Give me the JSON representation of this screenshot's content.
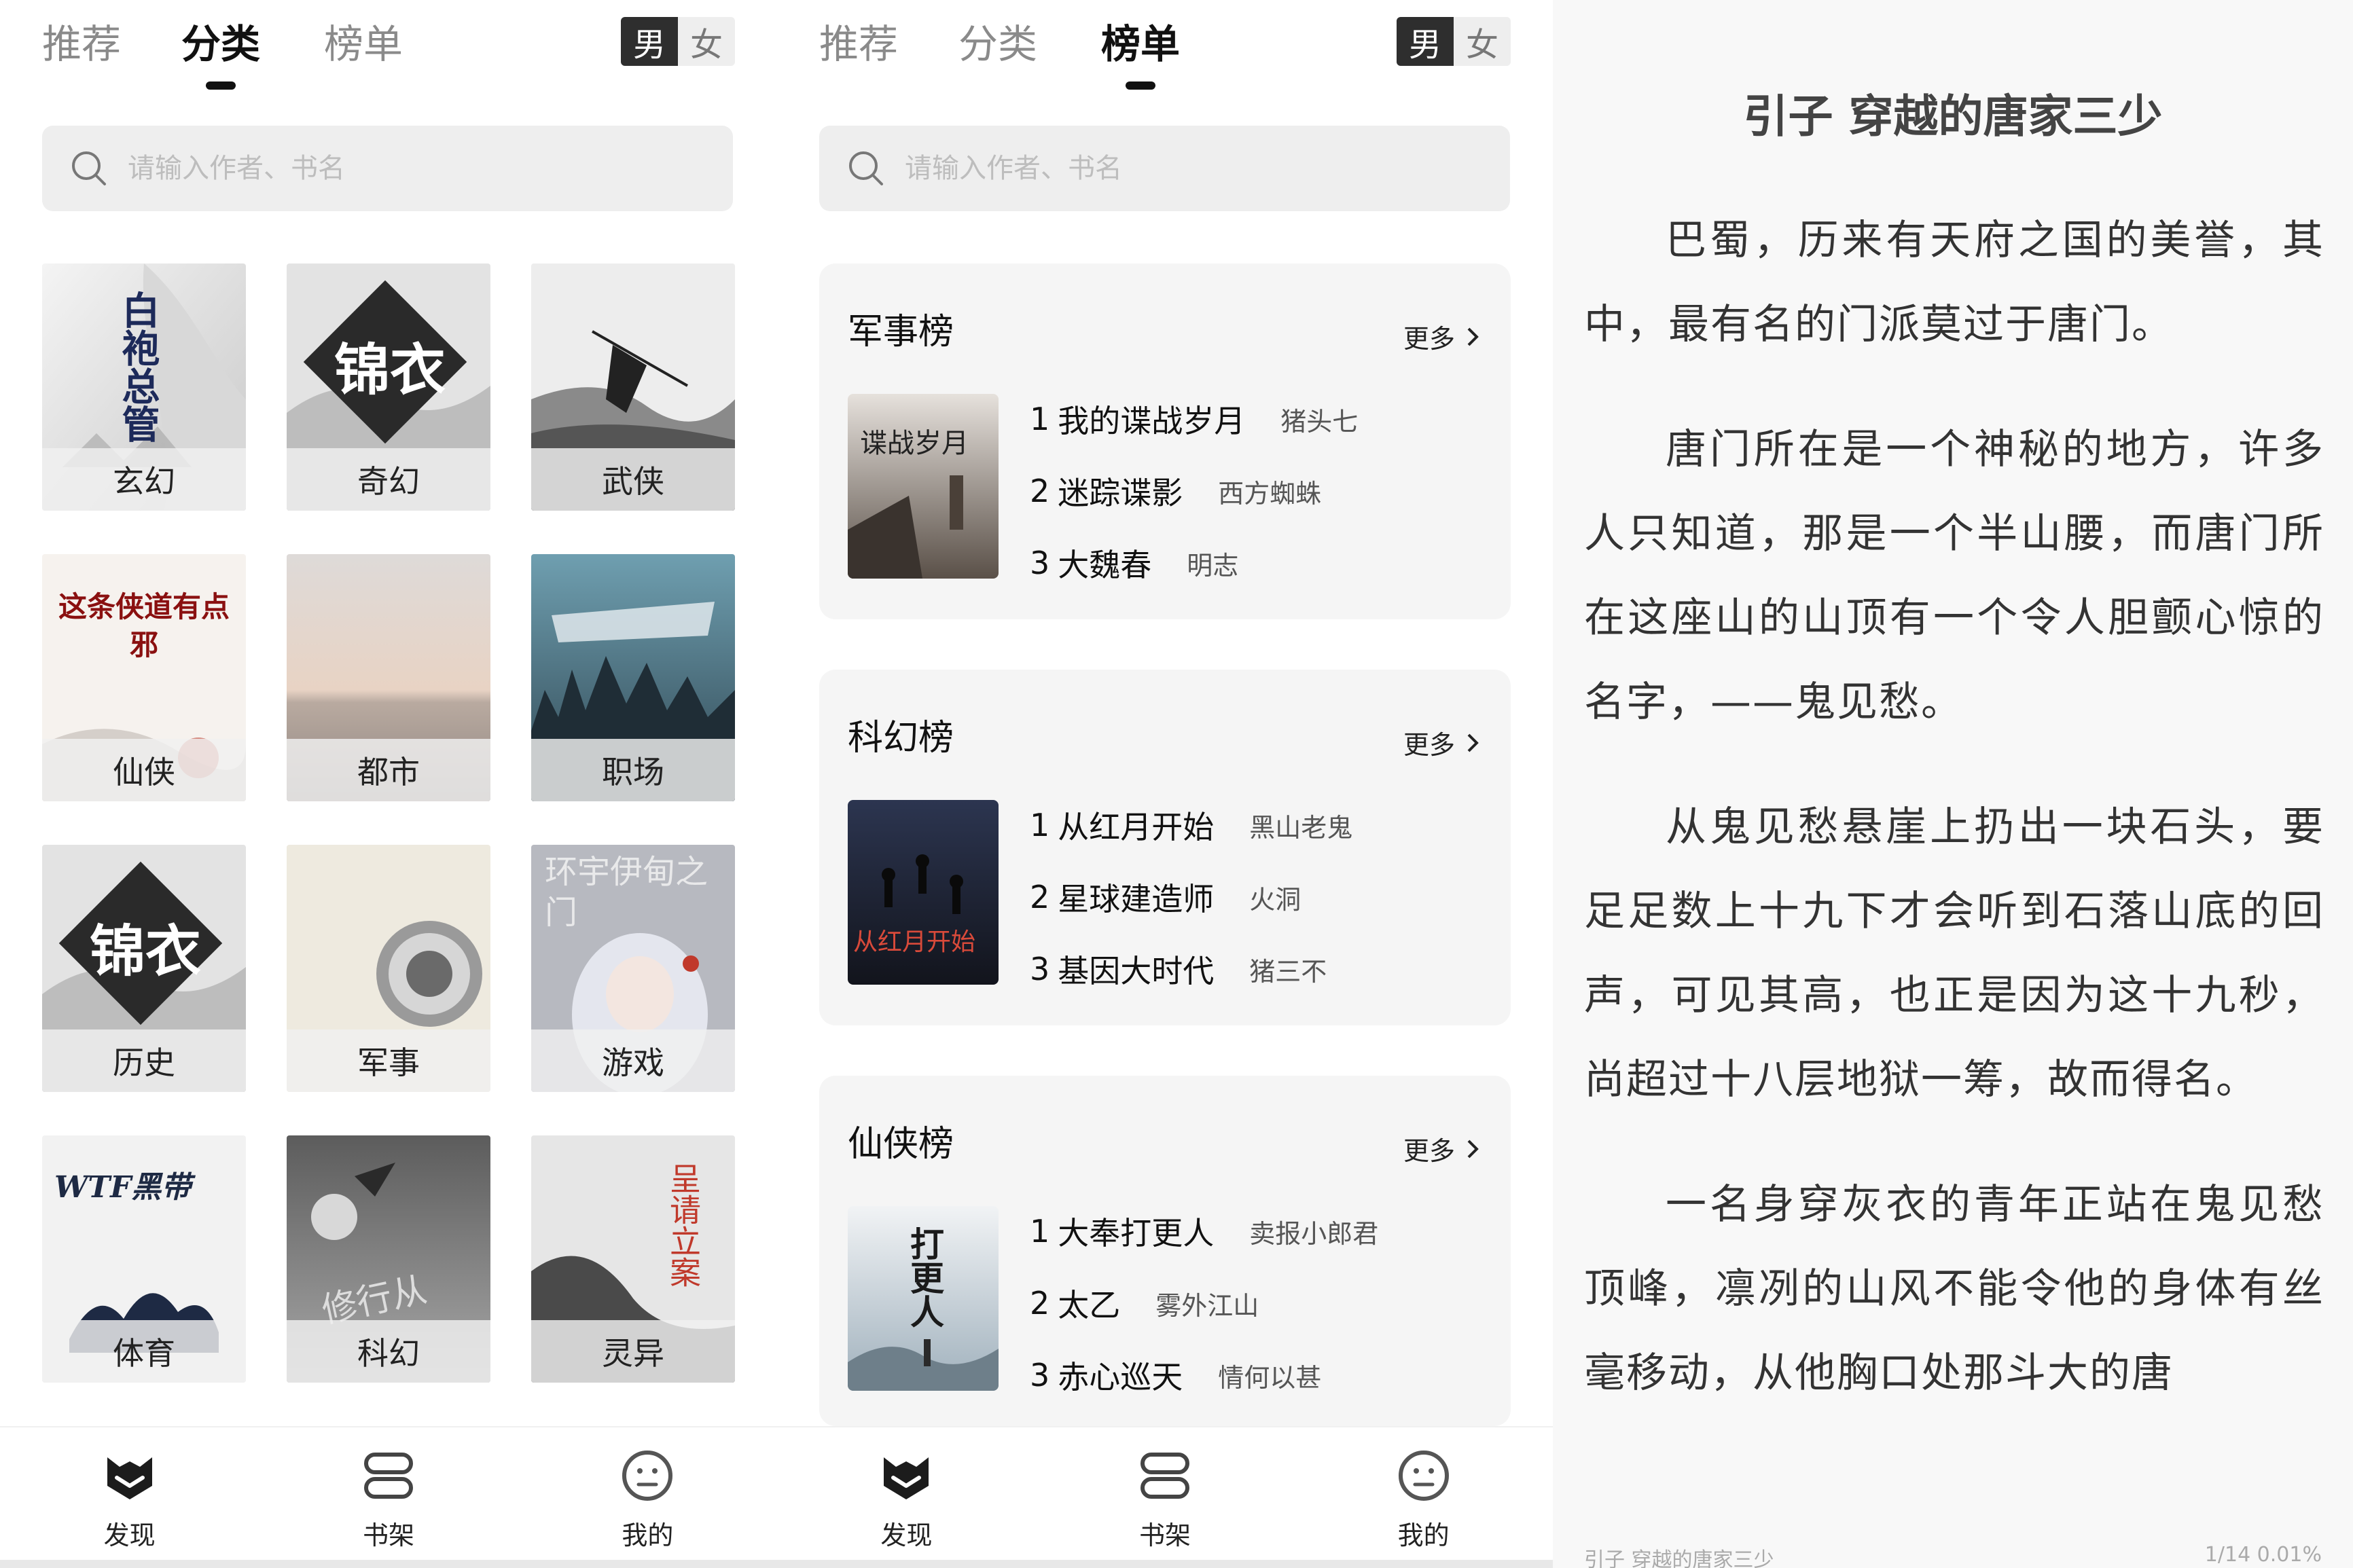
{
  "panel1": {
    "tabs": [
      "推荐",
      "分类",
      "榜单"
    ],
    "active_tab": "分类",
    "gender": {
      "male": "男",
      "female": "女",
      "selected": "男"
    },
    "search_placeholder": "请输入作者、书名",
    "categories": [
      {
        "label": "玄幻",
        "cover_text": "白袍总管"
      },
      {
        "label": "奇幻",
        "cover_text": "锦衣"
      },
      {
        "label": "武侠",
        "cover_text": ""
      },
      {
        "label": "仙侠",
        "cover_text": "这条侠道有点邪"
      },
      {
        "label": "都市",
        "cover_text": ""
      },
      {
        "label": "职场",
        "cover_text": ""
      },
      {
        "label": "历史",
        "cover_text": "锦衣"
      },
      {
        "label": "军事",
        "cover_text": ""
      },
      {
        "label": "游戏",
        "cover_text": "环宇伊甸之门"
      },
      {
        "label": "体育",
        "cover_text": "WTF黑带"
      },
      {
        "label": "科幻",
        "cover_text": "修行从"
      },
      {
        "label": "灵异",
        "cover_text": "呈请立案"
      }
    ]
  },
  "panel2": {
    "tabs": [
      "推荐",
      "分类",
      "榜单"
    ],
    "active_tab": "榜单",
    "gender": {
      "male": "男",
      "female": "女",
      "selected": "男"
    },
    "search_placeholder": "请输入作者、书名",
    "more_label": "更多",
    "rankings": [
      {
        "title": "军事榜",
        "cover_text": "谍战岁月",
        "books": [
          {
            "rank": "1",
            "title": "我的谍战岁月",
            "author": "猪头七"
          },
          {
            "rank": "2",
            "title": "迷踪谍影",
            "author": "西方蜘蛛"
          },
          {
            "rank": "3",
            "title": "大魏春",
            "author": "明志"
          }
        ]
      },
      {
        "title": "科幻榜",
        "cover_text": "从红月开始",
        "books": [
          {
            "rank": "1",
            "title": "从红月开始",
            "author": "黑山老鬼"
          },
          {
            "rank": "2",
            "title": "星球建造师",
            "author": "火洞"
          },
          {
            "rank": "3",
            "title": "基因大时代",
            "author": "猪三不"
          }
        ]
      },
      {
        "title": "仙侠榜",
        "cover_text": "打更人",
        "books": [
          {
            "rank": "1",
            "title": "大奉打更人",
            "author": "卖报小郎君"
          },
          {
            "rank": "2",
            "title": "太乙",
            "author": "雾外江山"
          },
          {
            "rank": "3",
            "title": "赤心巡天",
            "author": "情何以甚"
          }
        ]
      }
    ]
  },
  "nav": {
    "items": [
      {
        "label": "发现",
        "icon": "discover-icon"
      },
      {
        "label": "书架",
        "icon": "bookshelf-icon"
      },
      {
        "label": "我的",
        "icon": "profile-icon"
      }
    ]
  },
  "reader": {
    "chapter_title": "引子 穿越的唐家三少",
    "paragraphs": [
      "巴蜀，历来有天府之国的美誉，其中，最有名的门派莫过于唐门。",
      "唐门所在是一个神秘的地方，许多人只知道，那是一个半山腰，而唐门所在这座山的山顶有一个令人胆颤心惊的名字，——鬼见愁。",
      "从鬼见愁悬崖上扔出一块石头，要足足数上十九下才会听到石落山底的回声，可见其高，也正是因为这十九秒，尚超过十八层地狱一筹，故而得名。",
      "一名身穿灰衣的青年正站在鬼见愁顶峰，凛冽的山风不能令他的身体有丝毫移动，从他胸口处那斗大的唐"
    ],
    "footer_title": "引子 穿越的唐家三少",
    "footer_progress": "1/14    0.01%"
  }
}
